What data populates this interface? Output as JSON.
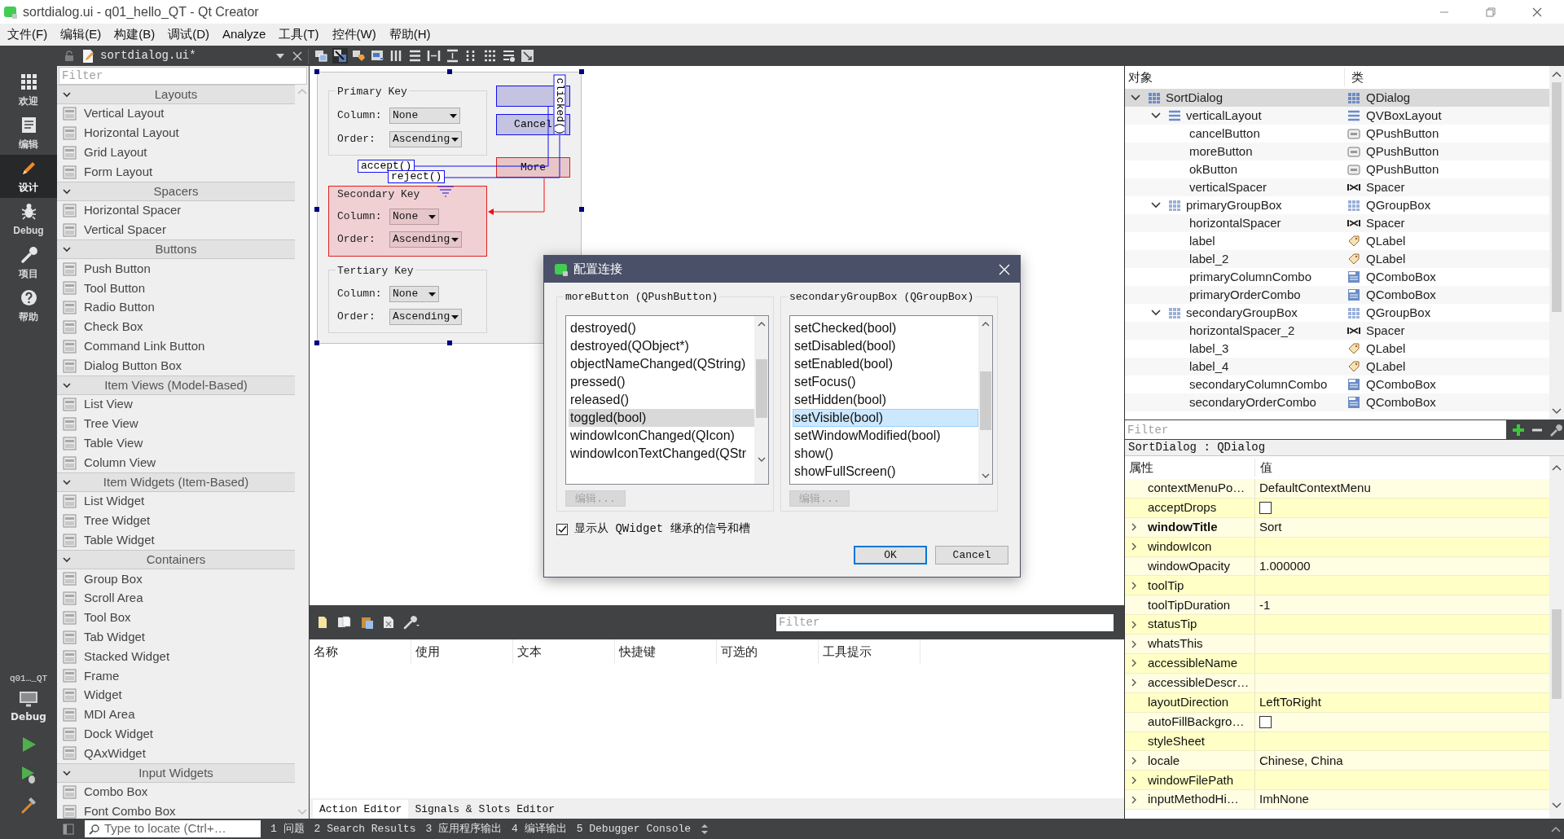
{
  "window": {
    "title": "sortdialog.ui - q01_hello_QT - Qt Creator"
  },
  "menu": [
    "文件(F)",
    "编辑(E)",
    "构建(B)",
    "调试(D)",
    "Analyze",
    "工具(T)",
    "控件(W)",
    "帮助(H)"
  ],
  "modes": [
    {
      "label": "欢迎",
      "kind": "welcome",
      "selected": false
    },
    {
      "label": "编辑",
      "kind": "edit",
      "selected": false
    },
    {
      "label": "设计",
      "kind": "design",
      "selected": true
    },
    {
      "label": "Debug",
      "kind": "debug",
      "selected": false
    },
    {
      "label": "项目",
      "kind": "projects",
      "selected": false
    },
    {
      "label": "帮助",
      "kind": "help",
      "selected": false
    }
  ],
  "target": {
    "project": "q01…_QT",
    "config": "Debug"
  },
  "editor_toolbar": {
    "file": "sortdialog.ui*"
  },
  "widget_box": {
    "placeholder": "Filter",
    "categories": [
      {
        "title": "Layouts",
        "expanded": true,
        "items": [
          "Vertical Layout",
          "Horizontal Layout",
          "Grid Layout",
          "Form Layout"
        ]
      },
      {
        "title": "Spacers",
        "expanded": true,
        "items": [
          "Horizontal Spacer",
          "Vertical Spacer"
        ]
      },
      {
        "title": "Buttons",
        "expanded": true,
        "items": [
          "Push Button",
          "Tool Button",
          "Radio Button",
          "Check Box",
          "Command Link Button",
          "Dialog Button Box"
        ]
      },
      {
        "title": "Item Views (Model-Based)",
        "expanded": true,
        "items": [
          "List View",
          "Tree View",
          "Table View",
          "Column View"
        ]
      },
      {
        "title": "Item Widgets (Item-Based)",
        "expanded": true,
        "items": [
          "List Widget",
          "Tree Widget",
          "Table Widget"
        ]
      },
      {
        "title": "Containers",
        "expanded": true,
        "items": [
          "Group Box",
          "Scroll Area",
          "Tool Box",
          "Tab Widget",
          "Stacked Widget",
          "Frame",
          "Widget",
          "MDI Area",
          "Dock Widget",
          "QAxWidget"
        ]
      },
      {
        "title": "Input Widgets",
        "expanded": true,
        "items": [
          "Combo Box",
          "Font Combo Box"
        ]
      }
    ]
  },
  "form": {
    "groups": [
      {
        "title": "Primary Key",
        "highlighted": false,
        "fields": [
          {
            "label": "Column:",
            "value": "None"
          },
          {
            "label": "Order:",
            "value": "Ascending"
          }
        ]
      },
      {
        "title": "Secondary Key",
        "highlighted": true,
        "fields": [
          {
            "label": "Column:",
            "value": "None"
          },
          {
            "label": "Order:",
            "value": "Ascending"
          }
        ]
      },
      {
        "title": "Tertiary Key",
        "highlighted": false,
        "fields": [
          {
            "label": "Column:",
            "value": "None"
          },
          {
            "label": "Order:",
            "value": "Ascending"
          }
        ]
      }
    ],
    "buttons": [
      {
        "label": "Cancel",
        "highlighted": false
      },
      {
        "label": "More",
        "highlighted": true
      }
    ],
    "signal": "clicked()",
    "slots": [
      "accept()",
      "reject()"
    ]
  },
  "connection_dialog": {
    "title": "配置连接",
    "sender": {
      "title": "moreButton (QPushButton)",
      "active": false,
      "edit_button": {
        "label": "编辑...",
        "disabled": true
      },
      "items": [
        {
          "label": "destroyed()",
          "selected": false
        },
        {
          "label": "destroyed(QObject*)",
          "selected": false
        },
        {
          "label": "objectNameChanged(QString)",
          "selected": false
        },
        {
          "label": "pressed()",
          "selected": false
        },
        {
          "label": "released()",
          "selected": false
        },
        {
          "label": "toggled(bool)",
          "selected": true
        },
        {
          "label": "windowIconChanged(QIcon)",
          "selected": false
        },
        {
          "label": "windowIconTextChanged(QStr",
          "selected": false
        }
      ]
    },
    "receiver": {
      "title": "secondaryGroupBox (QGroupBox)",
      "active": true,
      "edit_button": {
        "label": "编辑...",
        "disabled": true
      },
      "items": [
        {
          "label": "setChecked(bool)",
          "selected": false
        },
        {
          "label": "setDisabled(bool)",
          "selected": false
        },
        {
          "label": "setEnabled(bool)",
          "selected": false
        },
        {
          "label": "setFocus()",
          "selected": false
        },
        {
          "label": "setHidden(bool)",
          "selected": false
        },
        {
          "label": "setVisible(bool)",
          "selected": true
        },
        {
          "label": "setWindowModified(bool)",
          "selected": false
        },
        {
          "label": "show()",
          "selected": false
        },
        {
          "label": "showFullScreen()",
          "selected": false
        }
      ]
    },
    "inherited": {
      "label": "显示从 QWidget 继承的信号和槽",
      "checked": true
    },
    "buttons": [
      {
        "label": "OK",
        "default": true
      },
      {
        "label": "Cancel",
        "default": false
      }
    ]
  },
  "action_editor": {
    "placeholder": "Filter",
    "columns": [
      "名称",
      "使用",
      "文本",
      "快捷键",
      "可选的",
      "工具提示"
    ],
    "tabs": [
      {
        "label": "Action Editor",
        "selected": true
      },
      {
        "label": "Signals & Slots Editor",
        "selected": false
      }
    ]
  },
  "object_inspector": {
    "columns": [
      "对象",
      "类"
    ],
    "placeholder": "Filter",
    "tree": [
      {
        "name": "SortDialog",
        "class": "QDialog",
        "kind": "dialog",
        "selected": true,
        "expanded": true,
        "children": [
          {
            "name": "verticalLayout",
            "class": "QVBoxLayout",
            "kind": "layout",
            "selected": false,
            "expanded": true,
            "children": [
              {
                "name": "cancelButton",
                "class": "QPushButton",
                "kind": "button",
                "selected": false
              },
              {
                "name": "moreButton",
                "class": "QPushButton",
                "kind": "button",
                "selected": false
              },
              {
                "name": "okButton",
                "class": "QPushButton",
                "kind": "button",
                "selected": false
              },
              {
                "name": "verticalSpacer",
                "class": "Spacer",
                "kind": "spacer",
                "selected": false
              }
            ]
          },
          {
            "name": "primaryGroupBox",
            "class": "QGroupBox",
            "kind": "groupbox",
            "selected": false,
            "expanded": true,
            "children": [
              {
                "name": "horizontalSpacer",
                "class": "Spacer",
                "kind": "spacer",
                "selected": false
              },
              {
                "name": "label",
                "class": "QLabel",
                "kind": "label",
                "selected": false
              },
              {
                "name": "label_2",
                "class": "QLabel",
                "kind": "label",
                "selected": false
              },
              {
                "name": "primaryColumnCombo",
                "class": "QComboBox",
                "kind": "combobox",
                "selected": false
              },
              {
                "name": "primaryOrderCombo",
                "class": "QComboBox",
                "kind": "combobox",
                "selected": false
              }
            ]
          },
          {
            "name": "secondaryGroupBox",
            "class": "QGroupBox",
            "kind": "groupbox",
            "selected": false,
            "expanded": true,
            "children": [
              {
                "name": "horizontalSpacer_2",
                "class": "Spacer",
                "kind": "spacer",
                "selected": false
              },
              {
                "name": "label_3",
                "class": "QLabel",
                "kind": "label",
                "selected": false
              },
              {
                "name": "label_4",
                "class": "QLabel",
                "kind": "label",
                "selected": false
              },
              {
                "name": "secondaryColumnCombo",
                "class": "QComboBox",
                "kind": "combobox",
                "selected": false
              },
              {
                "name": "secondaryOrderCombo",
                "class": "QComboBox",
                "kind": "combobox",
                "selected": false
              }
            ]
          }
        ]
      }
    ]
  },
  "property_editor": {
    "object": "SortDialog : QDialog",
    "columns": [
      "属性",
      "值"
    ],
    "rows": [
      {
        "name": "contextMenuPo…",
        "kind": "text",
        "value": "DefaultContextMenu",
        "expandable": false,
        "modified": false
      },
      {
        "name": "acceptDrops",
        "kind": "checkbox",
        "checked": false,
        "expandable": false,
        "modified": false
      },
      {
        "name": "windowTitle",
        "kind": "text",
        "value": "Sort",
        "expandable": true,
        "modified": true
      },
      {
        "name": "windowIcon",
        "kind": "text",
        "expandable": true,
        "modified": false
      },
      {
        "name": "windowOpacity",
        "kind": "text",
        "value": "1.000000",
        "expandable": false,
        "modified": false
      },
      {
        "name": "toolTip",
        "kind": "text",
        "expandable": true,
        "modified": false
      },
      {
        "name": "toolTipDuration",
        "kind": "text",
        "value": "-1",
        "expandable": false,
        "modified": false
      },
      {
        "name": "statusTip",
        "kind": "text",
        "expandable": true,
        "modified": false
      },
      {
        "name": "whatsThis",
        "kind": "text",
        "expandable": true,
        "modified": false
      },
      {
        "name": "accessibleName",
        "kind": "text",
        "expandable": true,
        "modified": false
      },
      {
        "name": "accessibleDescr…",
        "kind": "text",
        "expandable": true,
        "modified": false
      },
      {
        "name": "layoutDirection",
        "kind": "text",
        "value": "LeftToRight",
        "expandable": false,
        "modified": false
      },
      {
        "name": "autoFillBackgro…",
        "kind": "checkbox",
        "checked": false,
        "expandable": false,
        "modified": false
      },
      {
        "name": "styleSheet",
        "kind": "text",
        "expandable": false,
        "modified": false
      },
      {
        "name": "locale",
        "kind": "text",
        "value": "Chinese, China",
        "expandable": true,
        "modified": false
      },
      {
        "name": "windowFilePath",
        "kind": "text",
        "expandable": true,
        "modified": false
      },
      {
        "name": "inputMethodHi…",
        "kind": "text",
        "value": "ImhNone",
        "expandable": true,
        "modified": false
      }
    ]
  },
  "status_bar": {
    "placeholder": "Type to locate (Ctrl+…",
    "panes": [
      "1 问题",
      "2 Search Results",
      "3 应用程序输出",
      "4 编译输出",
      "5 Debugger Console"
    ]
  }
}
